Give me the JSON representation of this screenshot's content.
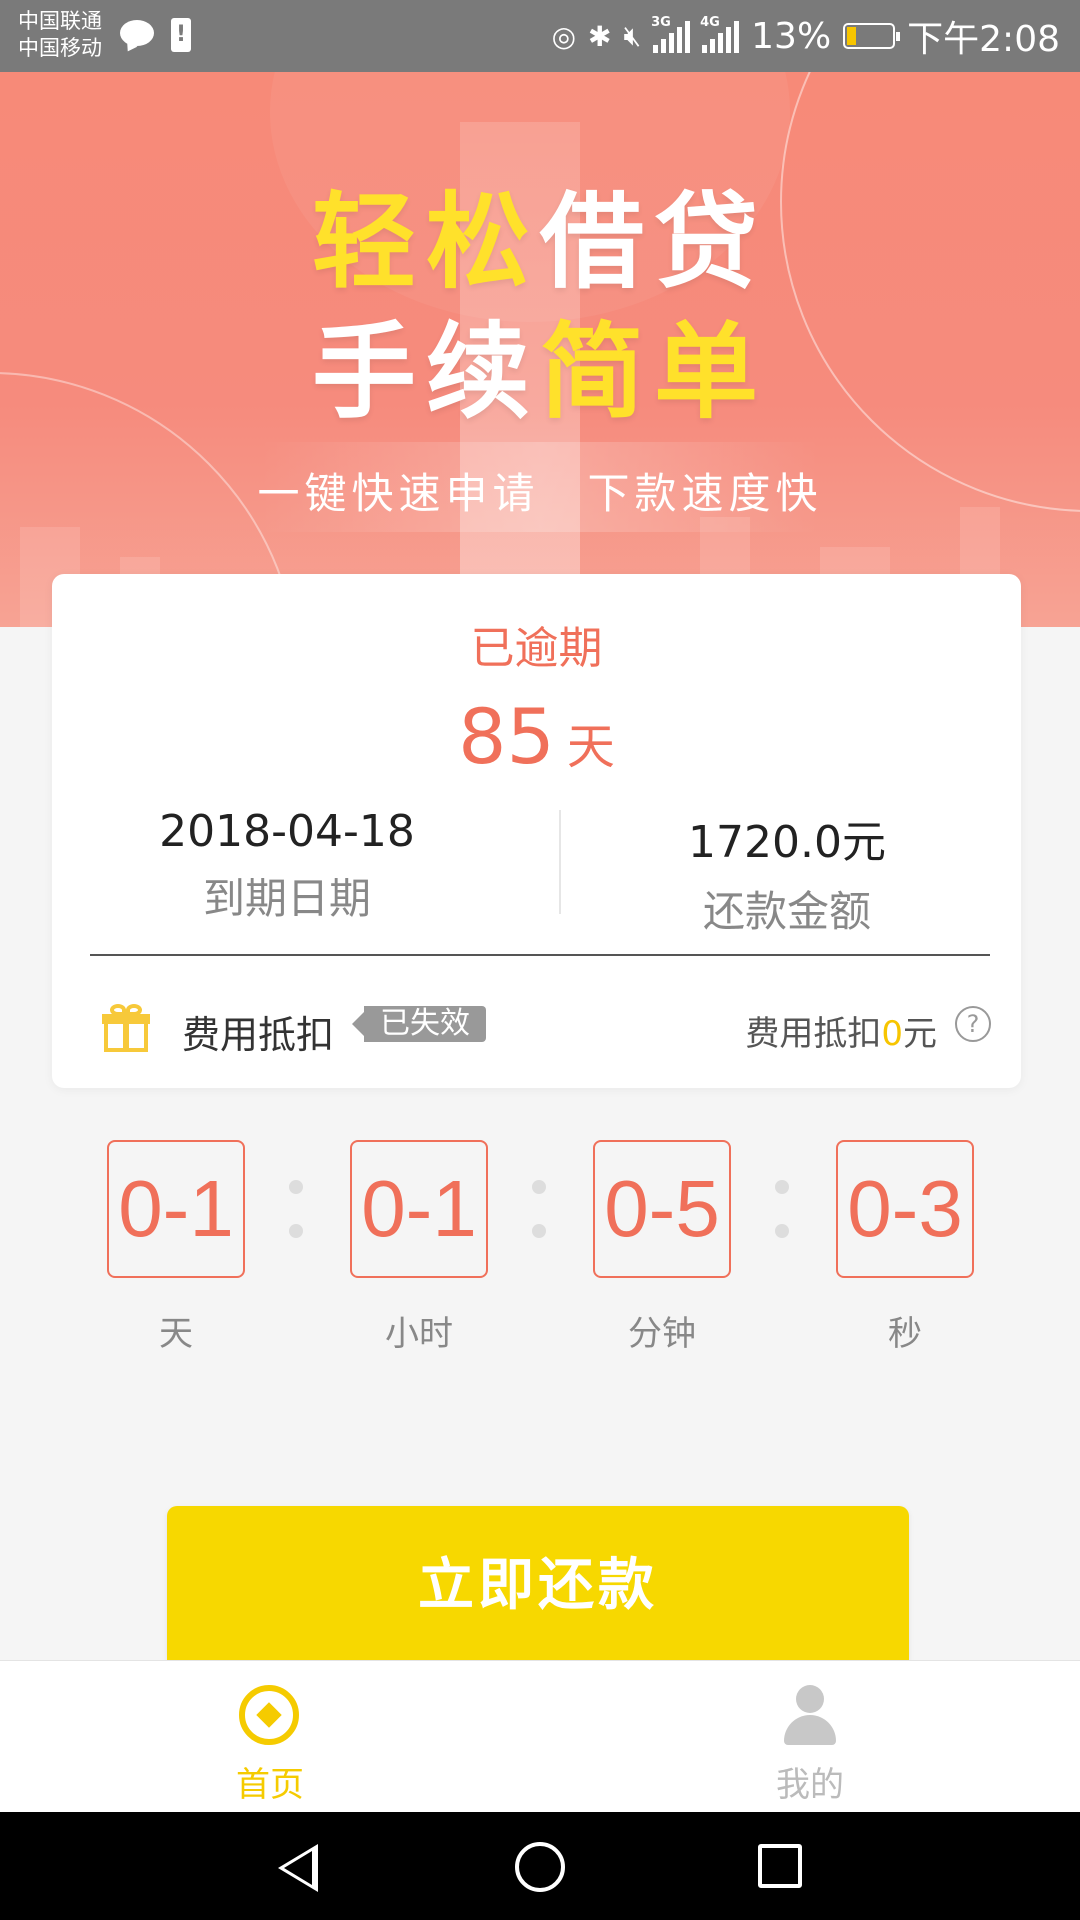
{
  "status_bar": {
    "carrier1": "中国联通",
    "carrier2": "中国移动",
    "battery": "13%",
    "time": "下午2:08",
    "net1": "3G",
    "net2": "4G"
  },
  "hero": {
    "line1_a": "轻松",
    "line1_b": "借贷",
    "line2_a": "手续",
    "line2_b": "简单",
    "sub1": "一键快速申请",
    "sub2": "下款速度快"
  },
  "card": {
    "status": "已逾期",
    "days": "85",
    "days_unit": "天",
    "due_date": "2018-04-18",
    "due_date_label": "到期日期",
    "amount": "1720.0元",
    "amount_label": "还款金额",
    "fee_label": "费用抵扣",
    "expired_tag": "已失效",
    "fee_right_prefix": "费用抵扣",
    "fee_right_amount": "0",
    "fee_right_suffix": "元",
    "help": "?"
  },
  "countdown": {
    "days": "0-1",
    "hours": "0-1",
    "minutes": "0-5",
    "seconds": "0-3",
    "days_label": "天",
    "hours_label": "小时",
    "minutes_label": "分钟",
    "seconds_label": "秒"
  },
  "repay_button": "立即还款",
  "tabs": {
    "home": "首页",
    "mine": "我的"
  },
  "colors": {
    "accent": "#f0705a",
    "yellow": "#f7d800"
  }
}
